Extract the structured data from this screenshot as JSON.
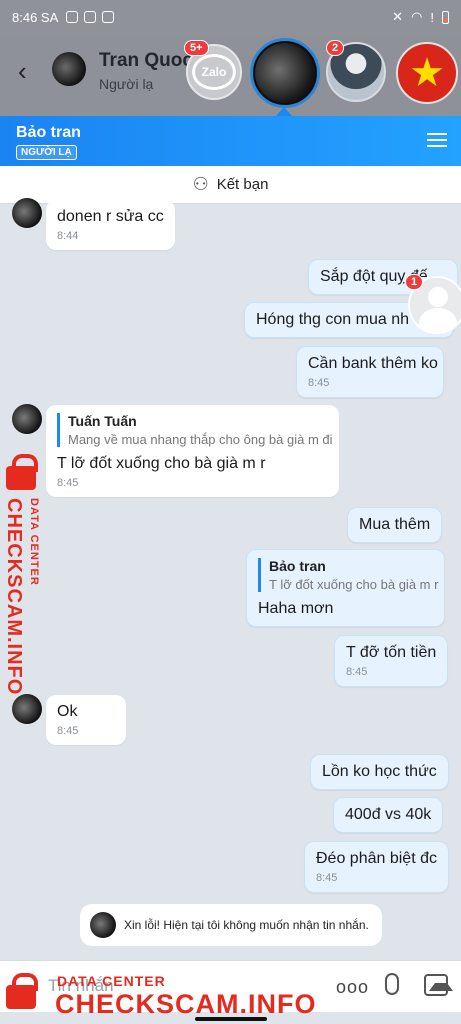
{
  "status_bar": {
    "time": "8:46 SA"
  },
  "header": {
    "name": "Tran Quoc",
    "subtitle": "Người lạ"
  },
  "chat_heads": [
    {
      "name": "Zalo",
      "badge": "5+"
    },
    {
      "name": "active-contact"
    },
    {
      "name": "anime-contact",
      "badge": "2"
    },
    {
      "name": "flag-contact"
    }
  ],
  "conversation": {
    "title": "Bảo tran",
    "tag": "NGƯỜI LẠ",
    "add_friend": "Kết bạn"
  },
  "messages": [
    {
      "from": "them",
      "text": "donen r sửa cc",
      "time": "8:44"
    },
    {
      "from": "me",
      "text": "Sắp đột quỵ đế"
    },
    {
      "from": "me",
      "text": "Hóng thg con mua nh"
    },
    {
      "from": "me",
      "text": "Cần bank thêm ko",
      "time": "8:45"
    },
    {
      "from": "them",
      "quote_name": "Tuấn Tuấn",
      "quote_text": "Mang về mua nhang thắp cho ông bà già m đi",
      "text": "T lỡ đốt xuống cho bà già m r",
      "time": "8:45"
    },
    {
      "from": "me",
      "text": "Mua thêm"
    },
    {
      "from": "me",
      "quote_name": "Bảo tran",
      "quote_text": "T lỡ đốt xuống cho bà già m r",
      "text": "Haha mơn"
    },
    {
      "from": "me",
      "text": "T đỡ tốn tiền",
      "time": "8:45"
    },
    {
      "from": "them",
      "text": "Ok",
      "time": "8:45"
    },
    {
      "from": "me",
      "text": "Lồn ko học thức"
    },
    {
      "from": "me",
      "text": "400đ vs 40k"
    },
    {
      "from": "me",
      "text": "Đéo phân biệt đc",
      "time": "8:45"
    }
  ],
  "notice": "Xin lỗi! Hiện tại tôi không muốn nhận tin nhắn.",
  "floating_badge": "1",
  "input": {
    "placeholder": "Tin nhắn",
    "more": "ooo"
  },
  "watermark": {
    "line1": "DATA CENTER",
    "line2": "CHECKSCAM.INFO"
  },
  "colors": {
    "accent": "#1e88f2",
    "watermark": "#e52b1f",
    "my_bubble": "#e6f3ff"
  }
}
